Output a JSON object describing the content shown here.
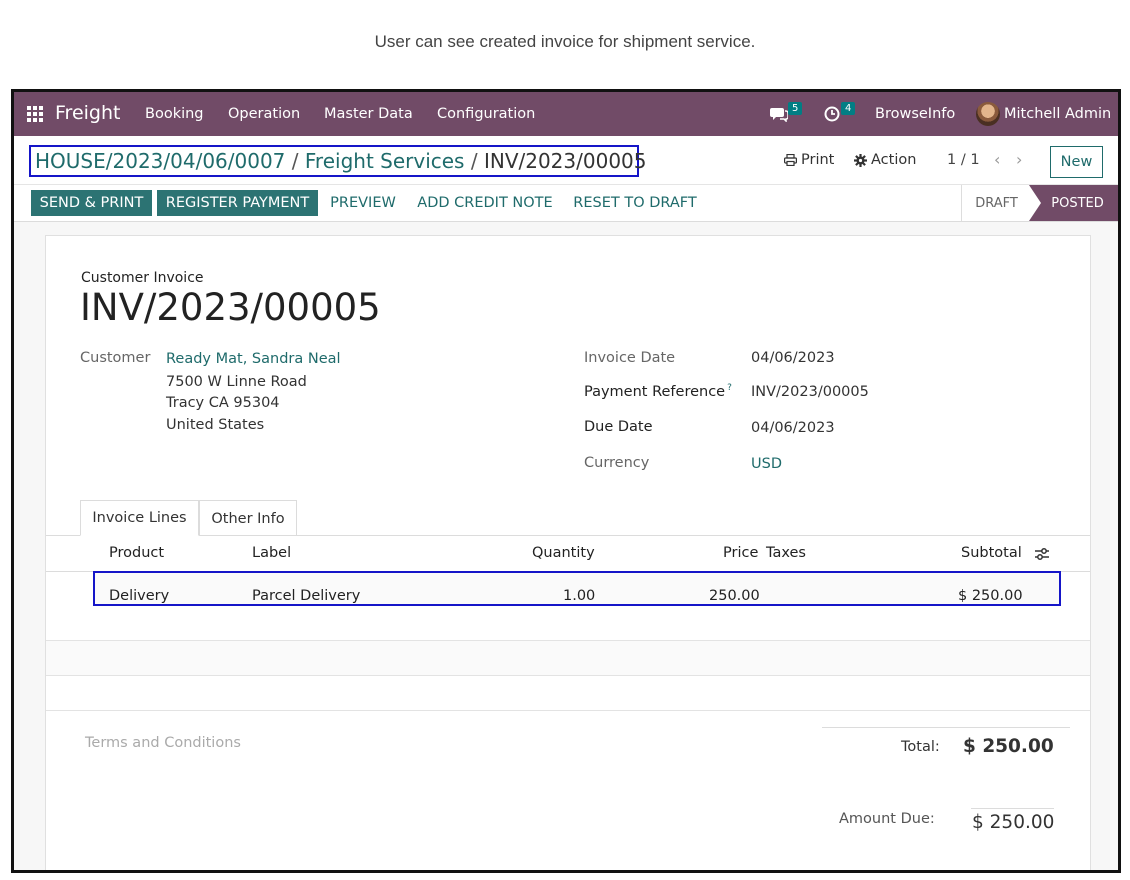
{
  "caption": "User can see created invoice for shipment service.",
  "navbar": {
    "brand": "Freight",
    "menu": [
      "Booking",
      "Operation",
      "Master Data",
      "Configuration"
    ],
    "chat_count": "5",
    "activity_count": "4",
    "company": "BrowseInfo",
    "user": "Mitchell Admin"
  },
  "control_panel": {
    "breadcrumb": [
      "HOUSE/2023/04/06/0007",
      "Freight Services",
      "INV/2023/00005"
    ],
    "separator": "/",
    "print": "Print",
    "action": "Action",
    "pager": "1 / 1",
    "new": "New"
  },
  "statusbar": {
    "buttons": [
      "SEND & PRINT",
      "REGISTER PAYMENT",
      "PREVIEW",
      "ADD CREDIT NOTE",
      "RESET TO DRAFT"
    ],
    "stages": [
      "DRAFT",
      "POSTED"
    ],
    "active_stage": "POSTED"
  },
  "invoice": {
    "type": "Customer Invoice",
    "number": "INV/2023/00005",
    "customer_label": "Customer",
    "customer_name": "Ready Mat, Sandra Neal",
    "address": [
      "7500 W Linne Road",
      "Tracy CA 95304",
      "United States"
    ],
    "invoice_date_label": "Invoice Date",
    "invoice_date": "04/06/2023",
    "payment_ref_label": "Payment Reference",
    "payment_ref_help": "?",
    "payment_ref": "INV/2023/00005",
    "due_date_label": "Due Date",
    "due_date": "04/06/2023",
    "currency_label": "Currency",
    "currency": "USD"
  },
  "tabs": [
    "Invoice Lines",
    "Other Info"
  ],
  "lines": {
    "headers": [
      "Product",
      "Label",
      "Quantity",
      "Price",
      "Taxes",
      "Subtotal"
    ],
    "rows": [
      {
        "product": "Delivery",
        "label": "Parcel Delivery",
        "quantity": "1.00",
        "price": "250.00",
        "taxes": "",
        "subtotal": "$ 250.00"
      }
    ]
  },
  "footer": {
    "terms_placeholder": "Terms and Conditions",
    "total_label": "Total:",
    "total_value": "$ 250.00",
    "amount_due_label": "Amount Due:",
    "amount_due_value": "$ 250.00"
  },
  "colors": {
    "navbar": "#714b67",
    "primary": "#2c7373",
    "link": "#1f6b6b",
    "highlight_box": "#1515c8"
  }
}
